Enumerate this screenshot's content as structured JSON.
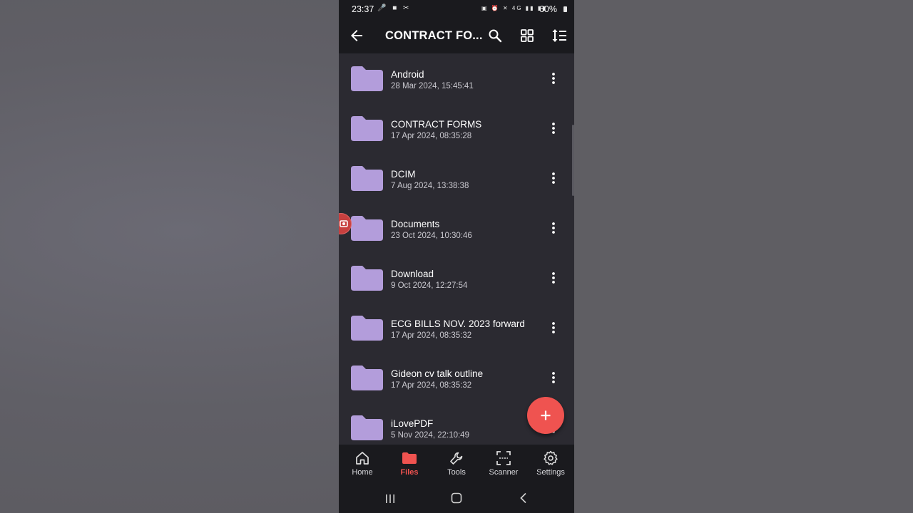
{
  "status_bar": {
    "time": "23:37",
    "battery": "60%",
    "network": "4G"
  },
  "app_bar": {
    "title": "CONTRACT FO...",
    "back_icon": "arrow-back-icon",
    "search_icon": "search-icon",
    "grid_icon": "grid-view-icon",
    "sort_icon": "sort-icon"
  },
  "folders": [
    {
      "name": "Android",
      "date": "28 Mar 2024, 15:45:41"
    },
    {
      "name": "CONTRACT FORMS",
      "date": "17 Apr 2024, 08:35:28"
    },
    {
      "name": "DCIM",
      "date": "7 Aug 2024, 13:38:38"
    },
    {
      "name": "Documents",
      "date": "23 Oct 2024, 10:30:46"
    },
    {
      "name": "Download",
      "date": "9 Oct 2024, 12:27:54"
    },
    {
      "name": "ECG BILLS NOV. 2023 forward",
      "date": "17 Apr 2024, 08:35:32"
    },
    {
      "name": "Gideon cv talk outline",
      "date": "17 Apr 2024, 08:35:32"
    },
    {
      "name": "iLovePDF",
      "date": "5 Nov 2024, 22:10:49"
    }
  ],
  "bottom_nav": [
    {
      "label": "Home",
      "icon": "home-icon",
      "active": false
    },
    {
      "label": "Files",
      "icon": "folder-icon",
      "active": true
    },
    {
      "label": "Tools",
      "icon": "wrench-icon",
      "active": false
    },
    {
      "label": "Scanner",
      "icon": "scanner-icon",
      "active": false
    },
    {
      "label": "Settings",
      "icon": "gear-icon",
      "active": false
    }
  ],
  "colors": {
    "folder": "#b39ddb",
    "accent": "#ef5350",
    "background": "#2b2a31",
    "bar": "#1a1a1e"
  }
}
